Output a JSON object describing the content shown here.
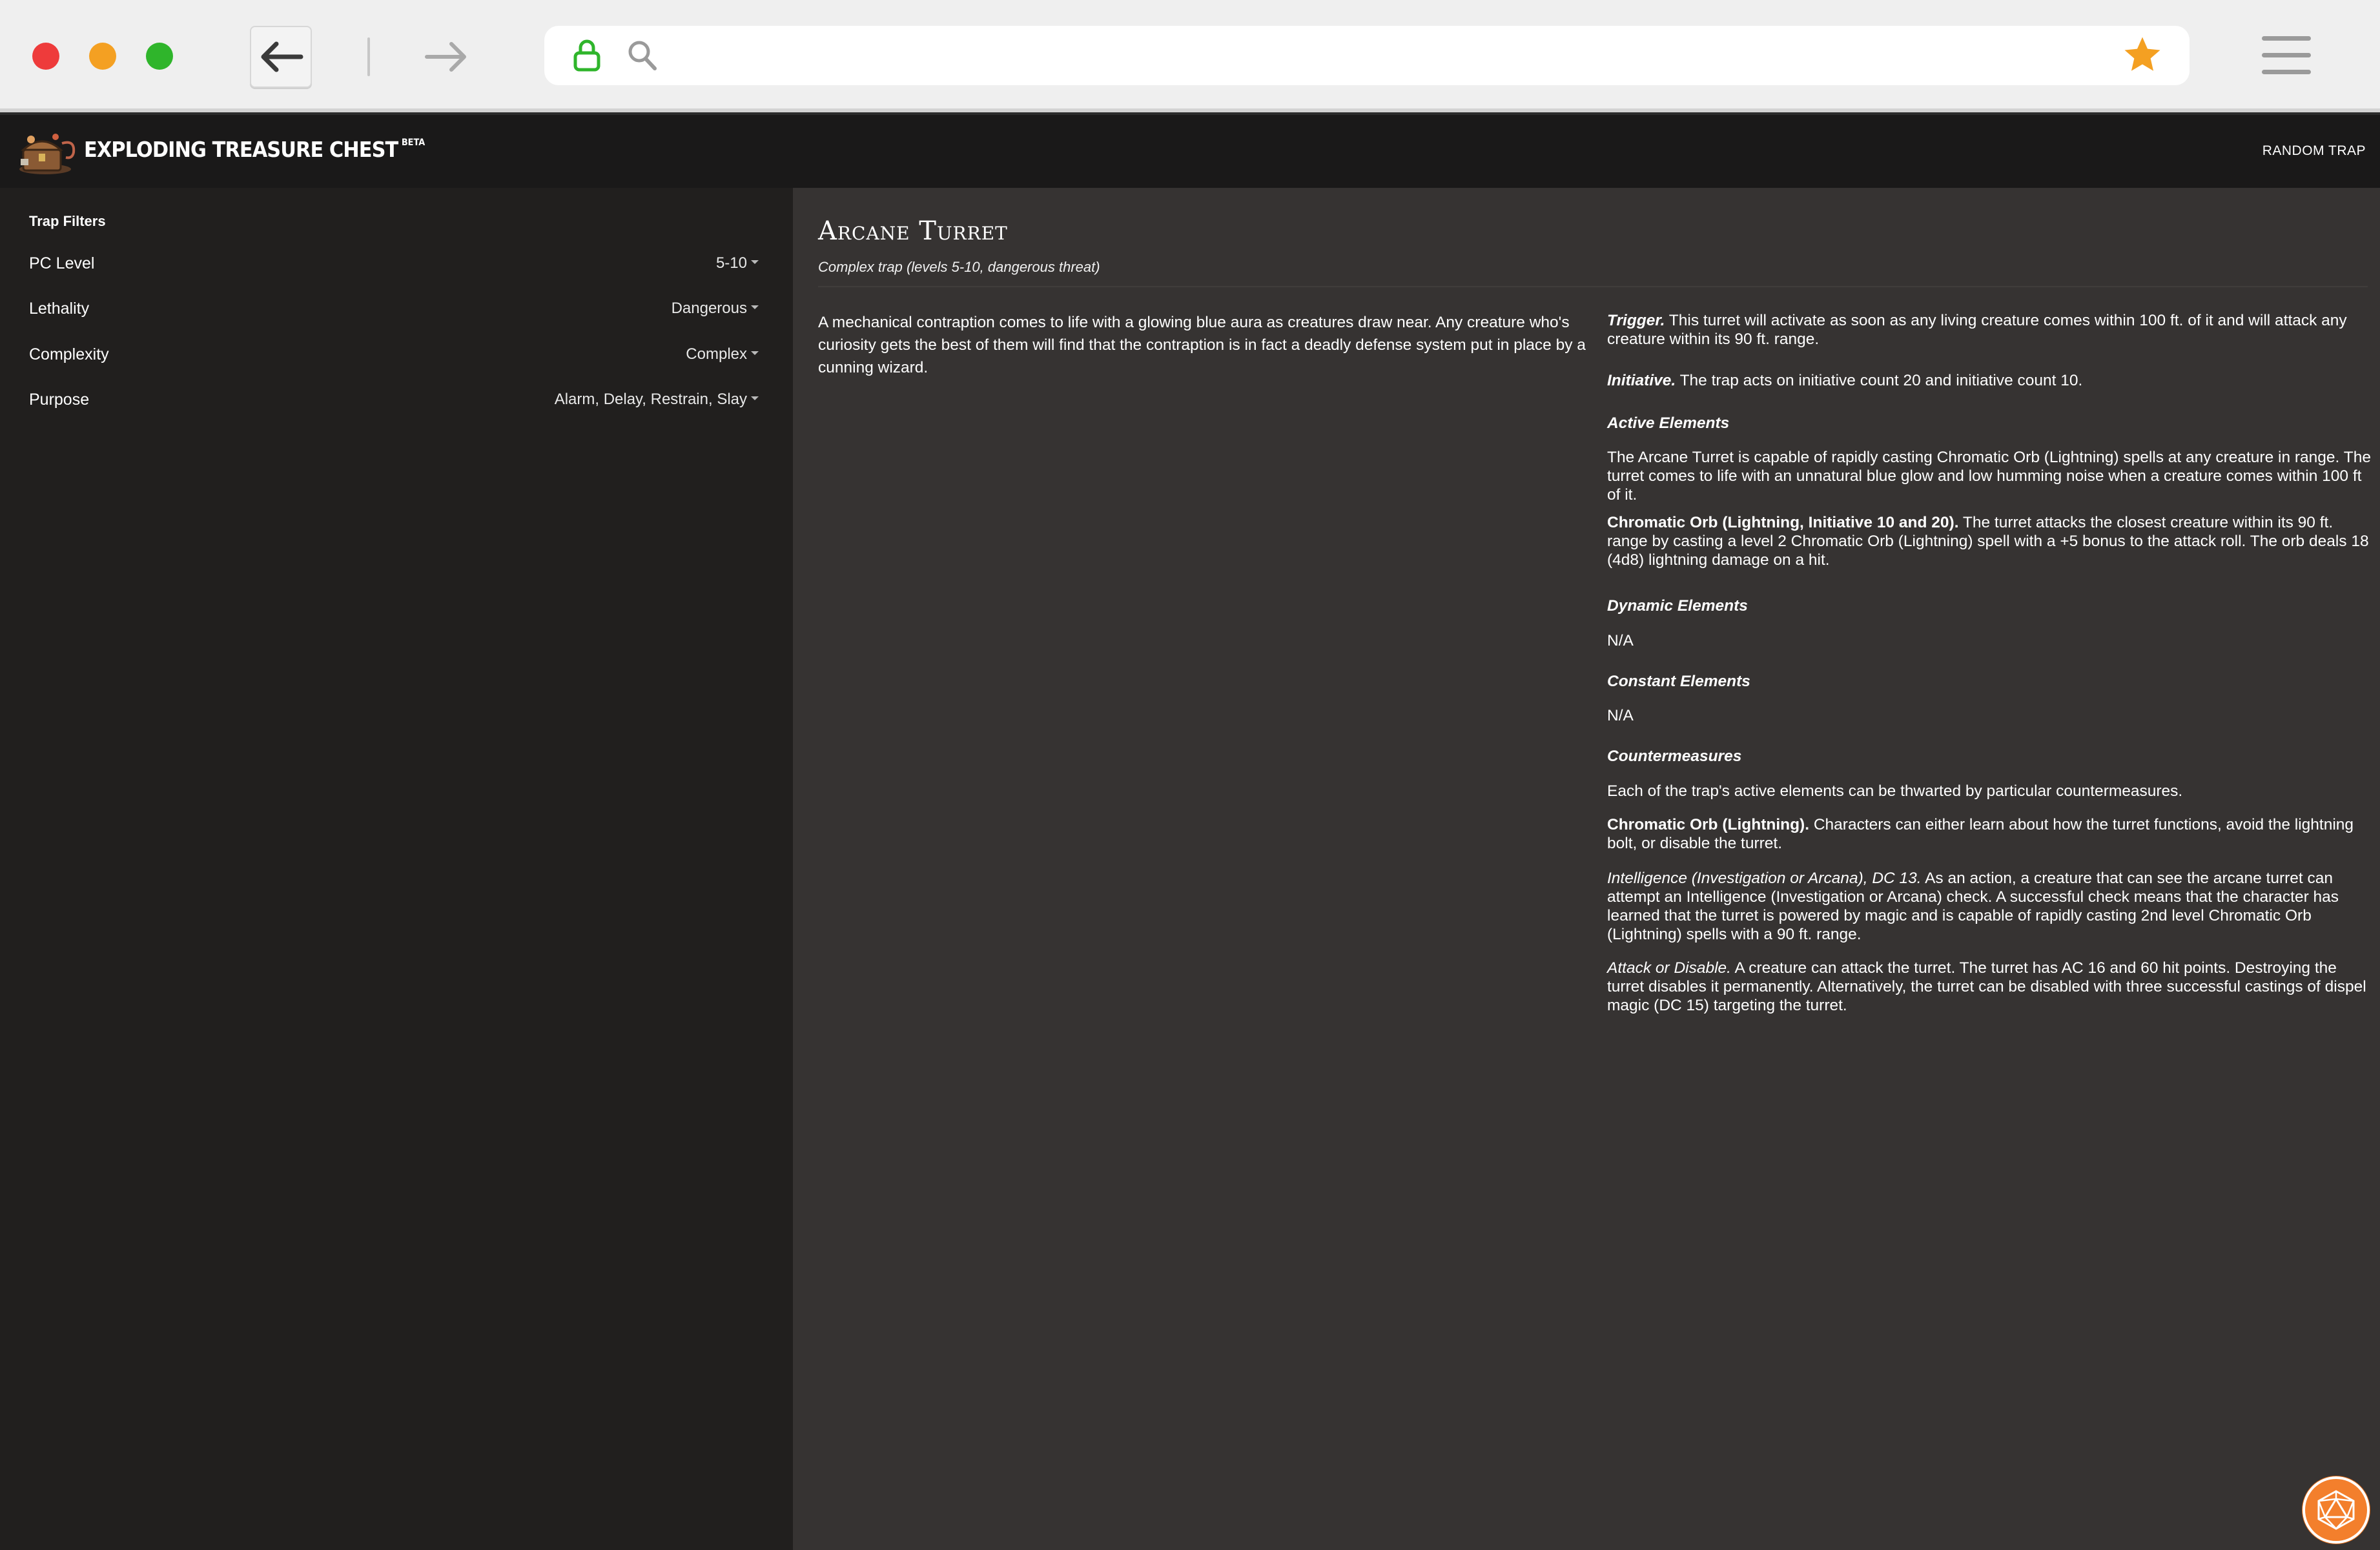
{
  "browser": {
    "url_value": "",
    "colors": {
      "lock": "#2fb52b",
      "star": "#f4a022"
    }
  },
  "header": {
    "brand": "EXPLODING TREASURE CHEST",
    "beta": "BETA",
    "random_trap": "RANDOM TRAP"
  },
  "sidebar": {
    "title": "Trap Filters",
    "filters": [
      {
        "label": "PC Level",
        "value": "5-10"
      },
      {
        "label": "Lethality",
        "value": "Dangerous"
      },
      {
        "label": "Complexity",
        "value": "Complex"
      },
      {
        "label": "Purpose",
        "value": "Alarm, Delay, Restrain, Slay"
      }
    ]
  },
  "trap": {
    "title": "Arcane Turret",
    "subtitle": "Complex trap (levels 5-10, dangerous threat)",
    "description": "A mechanical contraption comes to life with a glowing blue aura as creatures draw near. Any creature who's curiosity gets the best of them will find that the contraption is in fact a deadly defense system put in place by a cunning wizard.",
    "trigger_label": "Trigger.",
    "trigger_text": "This turret will activate as soon as any living creature comes within 100 ft. of it and will attack any creature within its 90 ft. range.",
    "initiative_label": "Initiative.",
    "initiative_text": "The trap acts on initiative count 20 and initiative count 10.",
    "active_heading": "Active Elements",
    "active_text": "The Arcane Turret is capable of rapidly casting Chromatic Orb (Lightning) spells at any creature in range. The turret comes to life with an unnatural blue glow and low humming noise when a creature comes within 100 ft of it.",
    "orb_label": "Chromatic Orb (Lightning, Initiative 10 and 20).",
    "orb_text": "The turret attacks the closest creature within its 90 ft. range by casting a level 2 Chromatic Orb (Lightning) spell with a +5 bonus to the attack roll. The orb deals 18 (4d8) lightning damage on a hit.",
    "dynamic_heading": "Dynamic Elements",
    "dynamic_text": "N/A",
    "constant_heading": "Constant Elements",
    "constant_text": "N/A",
    "counter_heading": "Countermeasures",
    "counter_text": "Each of the trap's active elements can be thwarted by particular countermeasures.",
    "counter_orb_label": "Chromatic Orb (Lightning).",
    "counter_orb_text": "Characters can either learn about how the turret functions, avoid the lightning bolt, or disable the turret.",
    "int_label": "Intelligence (Investigation or Arcana), DC 13.",
    "int_text": "As an action, a creature that can see the arcane turret can attempt an Intelligence (Investigation or Arcana) check. A successful check means that the character has learned that the turret is powered by magic and is capable of rapidly casting 2nd level Chromatic Orb (Lightning) spells with a 90 ft. range.",
    "attack_label": "Attack or Disable.",
    "attack_text": "A creature can attack the turret. The turret has AC 16 and 60 hit points. Destroying the turret disables it permanently. Alternatively, the turret can be disabled with three successful castings of dispel magic (DC 15) targeting the turret."
  }
}
